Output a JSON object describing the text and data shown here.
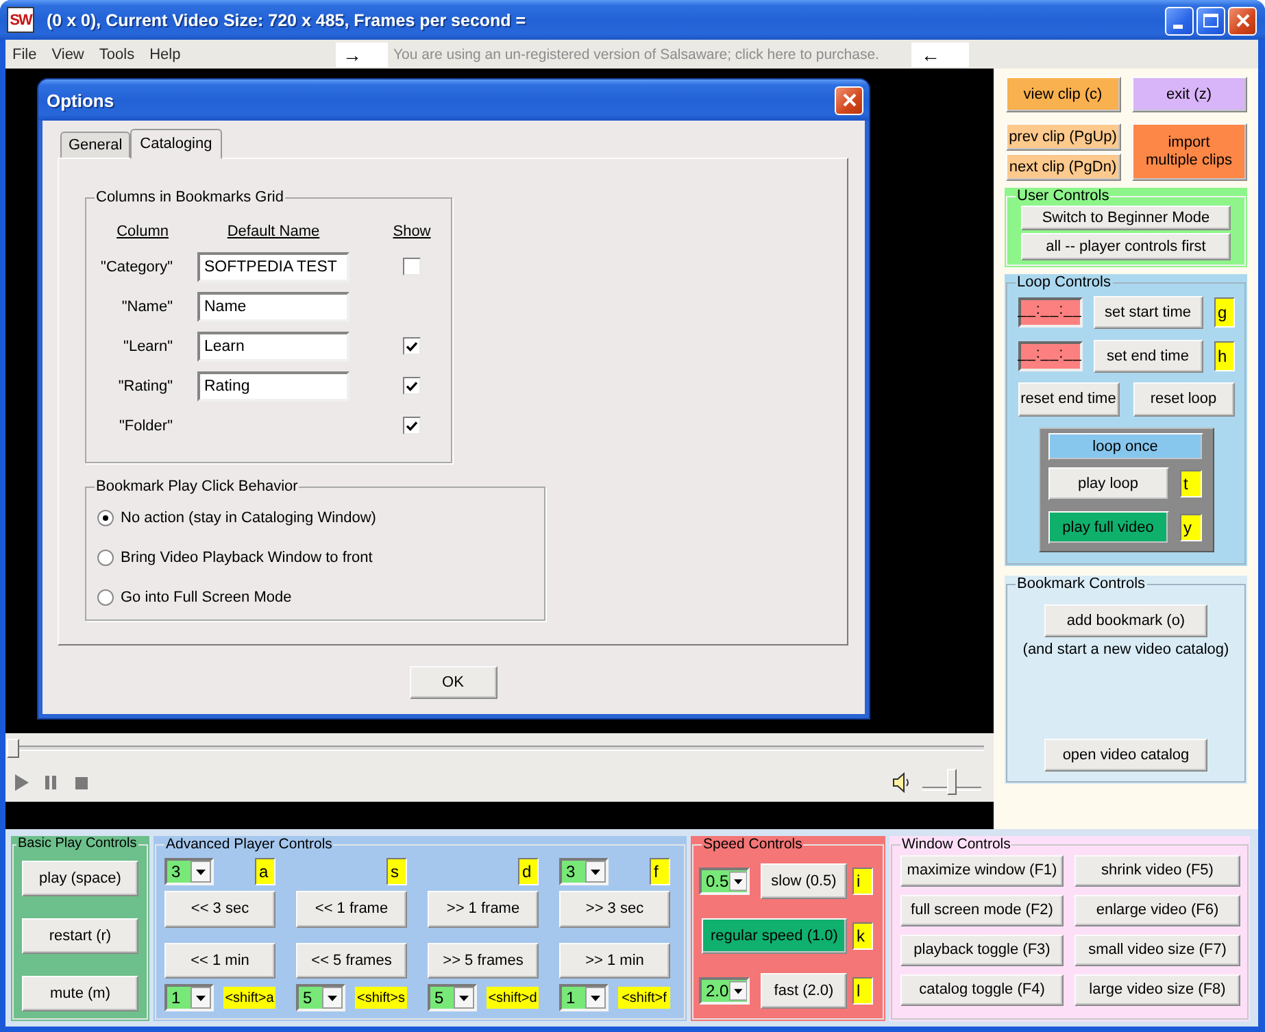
{
  "window": {
    "logo": "SW",
    "title": "(0 x 0), Current Video Size: 720 x 485, Frames per second ="
  },
  "menu": {
    "items": [
      "File",
      "View",
      "Tools",
      "Help"
    ],
    "notice": {
      "arrow_in": "→",
      "text": "You are using an un-registered version of Salsaware; click here to purchase.",
      "arrow_out": "←"
    }
  },
  "options_dialog": {
    "title": "Options",
    "tabs": [
      {
        "label": "General",
        "selected": false
      },
      {
        "label": "Cataloging",
        "selected": true
      }
    ],
    "columns_group": {
      "title": "Columns in Bookmarks Grid",
      "headers": [
        "Column",
        "Default Name",
        "Show"
      ],
      "rows": [
        {
          "kind": "full",
          "column": "\"Category\"",
          "default_name": "SOFTPEDIA TEST",
          "show": false
        },
        {
          "kind": "field",
          "column": "\"Name\"",
          "default_name": "Name"
        },
        {
          "kind": "full",
          "column": "\"Learn\"",
          "default_name": "Learn",
          "show": true
        },
        {
          "kind": "full",
          "column": "\"Rating\"",
          "default_name": "Rating",
          "show": true
        },
        {
          "kind": "checkbox",
          "column": "\"Folder\"",
          "show": true
        }
      ]
    },
    "behavior_group": {
      "title": "Bookmark Play Click Behavior",
      "options": [
        {
          "label": "No action (stay in Cataloging Window)",
          "selected": true
        },
        {
          "label": "Bring Video Playback Window to front",
          "selected": false
        },
        {
          "label": "Go into Full Screen Mode",
          "selected": false
        }
      ]
    },
    "ok": "OK"
  },
  "player": {
    "seek": {
      "level": 0
    },
    "volume": {
      "level": 0.5
    }
  },
  "clip_buttons": {
    "view": "view clip (c)",
    "exit": "exit (z)",
    "prev": "prev clip (PgUp)",
    "next": "next clip (PgDn)",
    "import": [
      "import",
      "multiple clips"
    ]
  },
  "user_controls": {
    "title": "User Controls",
    "buttons": [
      "Switch to Beginner Mode",
      "all -- player controls first"
    ]
  },
  "loop_controls": {
    "title": "Loop Controls",
    "points": [
      {
        "time": "__:__:__",
        "button": "set start time",
        "key": "g"
      },
      {
        "time": "__:__:__",
        "button": "set end time",
        "key": "h"
      }
    ],
    "resets": [
      "reset end time",
      "reset loop"
    ],
    "loop_once": "loop once",
    "play_modes": [
      {
        "label": "play loop",
        "key": "t",
        "selected": false
      },
      {
        "label": "play full video",
        "key": "y",
        "selected": true
      }
    ]
  },
  "bookmark_controls": {
    "title": "Bookmark Controls",
    "add": "add bookmark (o)",
    "note": "(and start a new video catalog)",
    "open": "open video catalog"
  },
  "basic_play_controls": {
    "title": "Basic Play Controls",
    "buttons": [
      "play (space)",
      "restart (r)",
      "mute (m)"
    ]
  },
  "advanced_player_controls": {
    "title": "Advanced Player Controls",
    "columns": [
      {
        "kind": "combo",
        "step": "3",
        "key": "a",
        "buttons": [
          "<< 3 sec",
          "<< 1 min"
        ],
        "bottom_step": "1",
        "bottom_key": "<shift>a"
      },
      {
        "kind": "plain",
        "key": "s",
        "buttons": [
          "<< 1 frame",
          "<< 5 frames"
        ],
        "bottom_step": "5",
        "bottom_key": "<shift>s"
      },
      {
        "kind": "plain",
        "key": "d",
        "buttons": [
          ">> 1 frame",
          ">> 5 frames"
        ],
        "bottom_step": "5",
        "bottom_key": "<shift>d"
      },
      {
        "kind": "combo",
        "step": "3",
        "key": "f",
        "buttons": [
          ">> 3 sec",
          ">> 1 min"
        ],
        "bottom_step": "1",
        "bottom_key": "<shift>f"
      }
    ]
  },
  "speed_controls": {
    "title": "Speed Controls",
    "rows": [
      {
        "kind": "combo",
        "rate": "0.5",
        "button": "slow (0.5)",
        "key": "i",
        "selected": false
      },
      {
        "kind": "plain",
        "button": "regular speed (1.0)",
        "key": "k",
        "selected": true
      },
      {
        "kind": "combo",
        "rate": "2.0",
        "button": "fast (2.0)",
        "key": "l",
        "selected": false
      }
    ]
  },
  "window_controls": {
    "title": "Window Controls",
    "buttons": [
      "maximize window (F1)",
      "shrink video (F5)",
      "full screen mode (F2)",
      "enlarge video (F6)",
      "playback toggle (F3)",
      "small video size (F7)",
      "catalog toggle (F4)",
      "large video size (F8)"
    ]
  }
}
